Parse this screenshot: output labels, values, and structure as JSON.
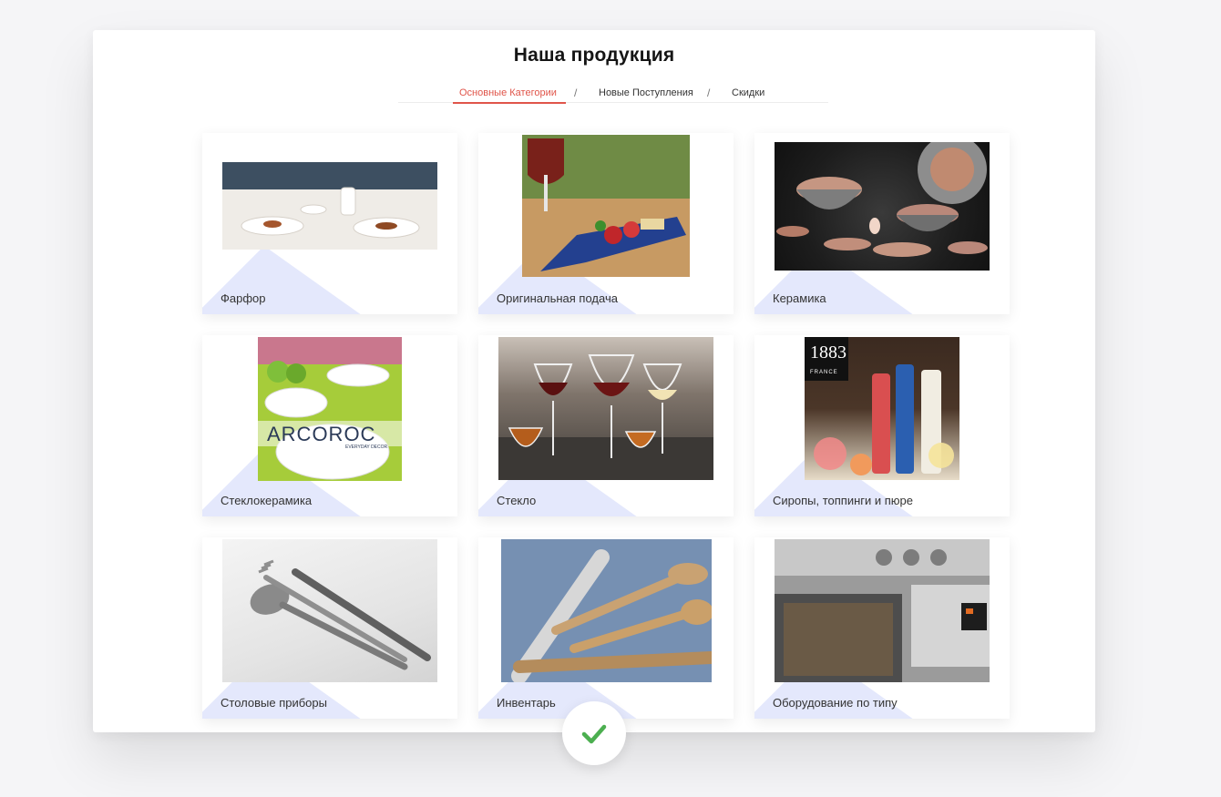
{
  "header": {
    "title": "Наша продукция"
  },
  "tabs": [
    {
      "label": "Основные Категории",
      "active": true
    },
    {
      "label": "Новые Поступления",
      "active": false
    },
    {
      "label": "Скидки",
      "active": false
    }
  ],
  "tab_separator": "/",
  "categories": [
    {
      "label": "Фарфор"
    },
    {
      "label": "Оригинальная подача"
    },
    {
      "label": "Керамика"
    },
    {
      "label": "Стеклокерамика"
    },
    {
      "label": "Стекло"
    },
    {
      "label": "Сиропы, топпинги и пюре"
    },
    {
      "label": "Столовые приборы"
    },
    {
      "label": "Инвентарь"
    },
    {
      "label": "Оборудование по типу"
    }
  ],
  "image_text": {
    "arcoroc": "ARCOROC",
    "arcoroc_sub": "EVERYDAY DECOR",
    "syrup_brand": "1883",
    "syrup_country": "FRANCE"
  },
  "colors": {
    "accent": "#e0554a",
    "diagonal": "#e4e8fc",
    "check": "#4caf50"
  },
  "icons": {
    "status": "check-icon"
  }
}
